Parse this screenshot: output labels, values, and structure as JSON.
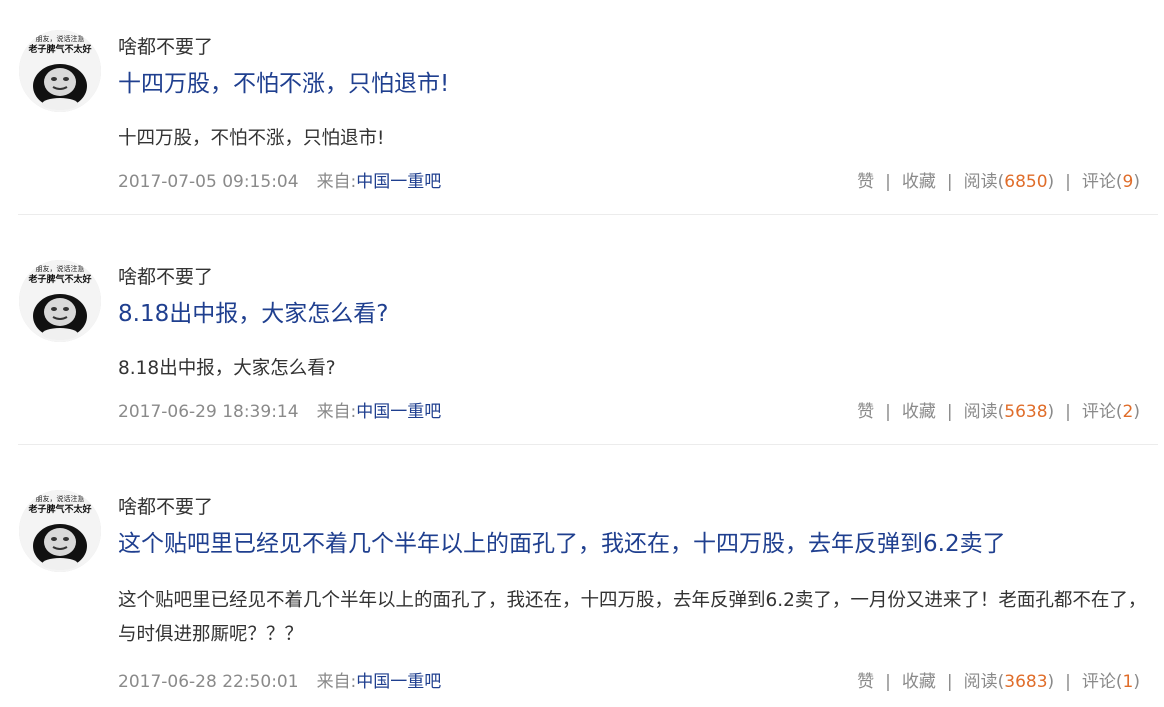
{
  "posts": [
    {
      "author": "啥都不要了",
      "avatar_caption": "老子脾气不太好",
      "avatar_caption_top": "朋友，说话注意",
      "title": "十四万股，不怕不涨，只怕退市!",
      "body": "十四万股，不怕不涨，只怕退市!",
      "timestamp": "2017-07-05 09:15:04",
      "from_label": "来自:",
      "source": "中国一重吧",
      "like_label": "赞",
      "favorite_label": "收藏",
      "read_label": "阅读(",
      "read_count": "6850",
      "comment_label": "评论(",
      "comment_count": "9",
      "close_paren": ")"
    },
    {
      "author": "啥都不要了",
      "avatar_caption": "老子脾气不太好",
      "avatar_caption_top": "朋友，说话注意",
      "title": "8.18出中报，大家怎么看?",
      "body": "8.18出中报，大家怎么看?",
      "timestamp": "2017-06-29 18:39:14",
      "from_label": "来自:",
      "source": "中国一重吧",
      "like_label": "赞",
      "favorite_label": "收藏",
      "read_label": "阅读(",
      "read_count": "5638",
      "comment_label": "评论(",
      "comment_count": "2",
      "close_paren": ")"
    },
    {
      "author": "啥都不要了",
      "avatar_caption": "老子脾气不太好",
      "avatar_caption_top": "朋友，说话注意",
      "title": "这个贴吧里已经见不着几个半年以上的面孔了，我还在，十四万股，去年反弹到6.2卖了",
      "body": "这个贴吧里已经见不着几个半年以上的面孔了，我还在，十四万股，去年反弹到6.2卖了，一月份又进来了！老面孔都不在了，与时俱进那厮呢？？？",
      "timestamp": "2017-06-28 22:50:01",
      "from_label": "来自:",
      "source": "中国一重吧",
      "like_label": "赞",
      "favorite_label": "收藏",
      "read_label": "阅读(",
      "read_count": "3683",
      "comment_label": "评论(",
      "comment_count": "1",
      "close_paren": ")"
    }
  ],
  "separator": "|",
  "colors": {
    "title": "#1f3f8f",
    "count": "#e06d2a",
    "meta": "#8a8a8a"
  }
}
